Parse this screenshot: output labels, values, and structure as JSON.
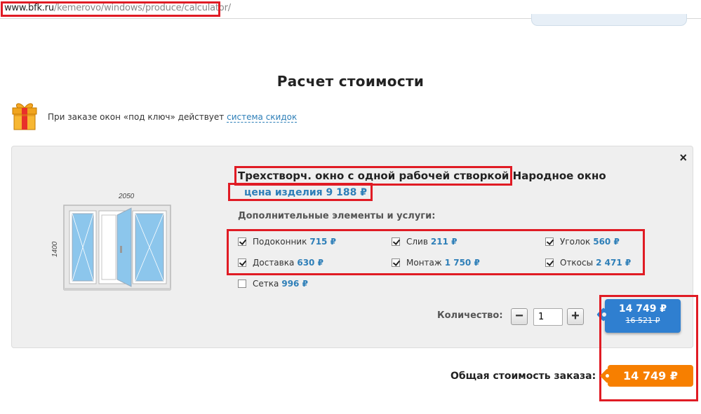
{
  "url": {
    "host": "www.bfk.ru",
    "path": "/kemerovo/windows/produce/calculator/"
  },
  "page": {
    "title": "Расчет стоимости"
  },
  "discount": {
    "text": "При заказе окон «под ключ» действует",
    "link": "система скидок"
  },
  "product": {
    "name_highlight": "Трехстворч. окно с одной рабочей створкой",
    "name_rest": " Народное окно",
    "price_line": "цена изделия 9 188 ₽",
    "image": {
      "width_label": "2050",
      "height_label": "1400"
    }
  },
  "extras": {
    "label": "Дополнительные элементы и услуги:",
    "items": [
      {
        "name": "Подоконник",
        "price": "715 ₽",
        "checked": true
      },
      {
        "name": "Слив",
        "price": "211 ₽",
        "checked": true
      },
      {
        "name": "Уголок",
        "price": "560 ₽",
        "checked": true
      },
      {
        "name": "Доставка",
        "price": "630 ₽",
        "checked": true
      },
      {
        "name": "Монтаж",
        "price": "1 750 ₽",
        "checked": true
      },
      {
        "name": "Откосы",
        "price": "2 471 ₽",
        "checked": true
      },
      {
        "name": "Сетка",
        "price": "996 ₽",
        "checked": false
      }
    ]
  },
  "quantity": {
    "label": "Количество:",
    "value": "1",
    "minus": "−",
    "plus": "+"
  },
  "item_price": {
    "new": "14 749 ₽",
    "old": "16 521 ₽"
  },
  "total": {
    "label": "Общая стоимость заказа:",
    "value": "14 749 ₽"
  },
  "close_symbol": "×",
  "colors": {
    "accent_blue": "#2f7fd0",
    "link_blue": "#2e7fb8",
    "orange": "#f77f00",
    "annotation_red": "#e01b24"
  }
}
